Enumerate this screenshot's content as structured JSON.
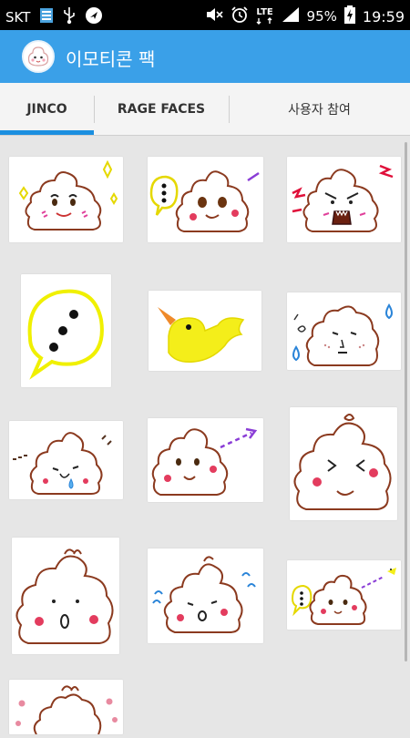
{
  "status_bar": {
    "carrier": "SKT",
    "network": "LTE",
    "battery": "95%",
    "time": "19:59",
    "icons": [
      "sim-icon",
      "usb-icon",
      "navigation-icon",
      "mute-icon",
      "alarm-icon",
      "lte-icon",
      "signal-icon",
      "battery-icon"
    ]
  },
  "app": {
    "title": "이모티콘 팩",
    "logo_icon": "app-logo-icon",
    "accent_color": "#3aa0e8",
    "tab_indicator_color": "#1b8fe0"
  },
  "tabs": [
    {
      "label": "JINCO",
      "selected": true
    },
    {
      "label": "RAGE FACES",
      "selected": false
    },
    {
      "label": "사용자 참여",
      "selected": false
    }
  ],
  "emoticons": [
    {
      "name": "emoticon-poop-sparkle-wink"
    },
    {
      "name": "emoticon-poop-speech-bubble"
    },
    {
      "name": "emoticon-poop-angry-roar"
    },
    {
      "name": "emoticon-speech-bubble-dots"
    },
    {
      "name": "emoticon-yellow-bird"
    },
    {
      "name": "emoticon-poop-sweat-drops"
    },
    {
      "name": "emoticon-poop-crying"
    },
    {
      "name": "emoticon-poop-arrow-glance"
    },
    {
      "name": "emoticon-poop-squint-smile"
    },
    {
      "name": "emoticon-poop-surprised"
    },
    {
      "name": "emoticon-poop-cold-shiver"
    },
    {
      "name": "emoticon-poop-bird-arrow"
    },
    {
      "name": "emoticon-poop-flowers"
    }
  ]
}
